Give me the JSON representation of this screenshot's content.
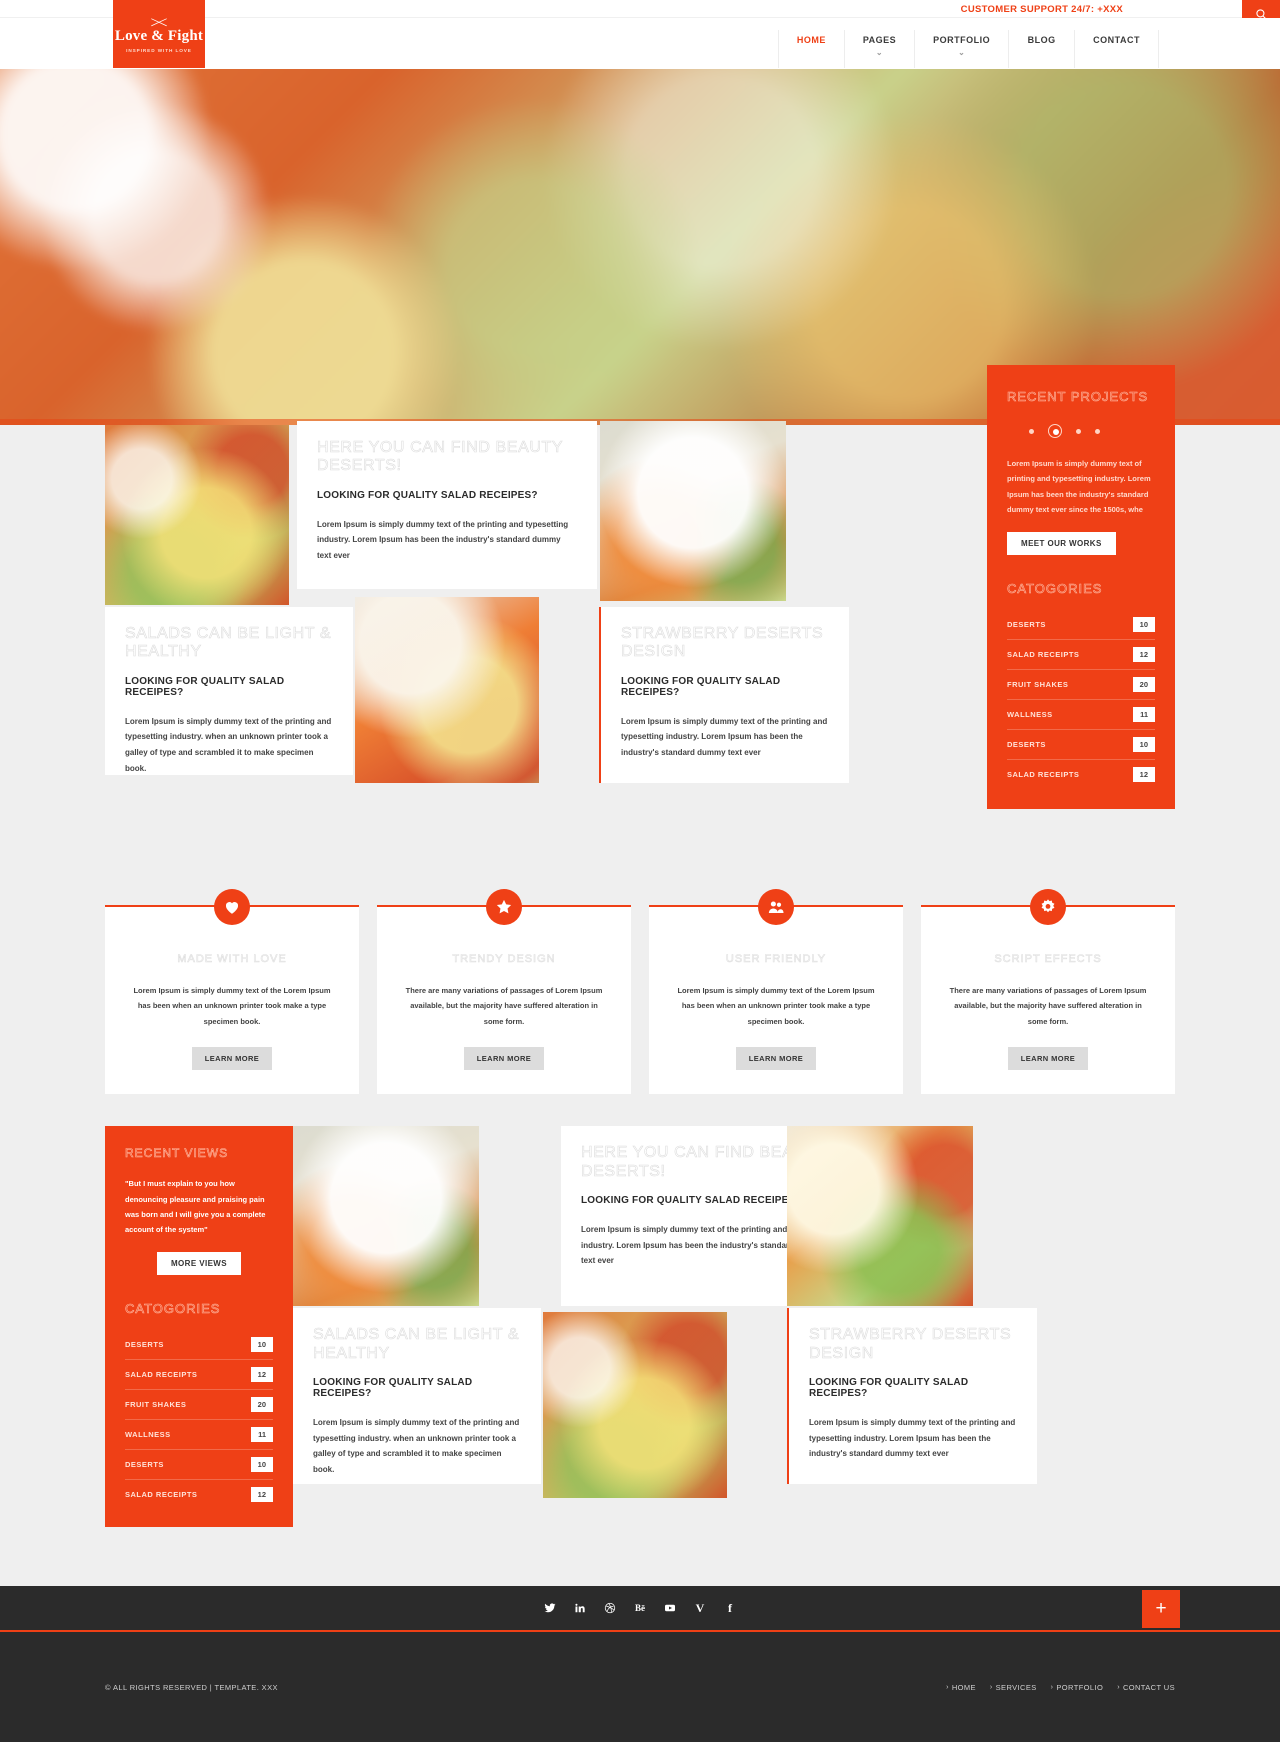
{
  "topbar": {
    "support": "CUSTOMER SUPPORT 24/7: +XXX",
    "search_icon": "search-icon"
  },
  "logo": {
    "title": "Love & Fight",
    "tagline": "INSPIRED WITH LOVE",
    "icon": "crossed-utensils-icon"
  },
  "nav": {
    "items": [
      {
        "label": "HOME",
        "caret": "",
        "active": true
      },
      {
        "label": "PAGES",
        "caret": "⌄",
        "active": false
      },
      {
        "label": "PORTFOLIO",
        "caret": "⌄",
        "active": false
      },
      {
        "label": "BLOG",
        "caret": "",
        "active": false
      },
      {
        "label": "CONTACT",
        "caret": "",
        "active": false
      }
    ]
  },
  "projects_panel": {
    "heading": "RECENT PROJECTS",
    "text": "Lorem Ipsum is simply dummy text of printing and typesetting industry. Lorem Ipsum has been the industry's standard dummy text ever since the 1500s, whe",
    "button": "MEET OUR WORKS",
    "categories_heading": "CATOGORIES",
    "categories": [
      {
        "name": "DESERTS",
        "count": "10"
      },
      {
        "name": "SALAD RECEIPTS",
        "count": "12"
      },
      {
        "name": "FRUIT SHAKES",
        "count": "20"
      },
      {
        "name": "WALLNESS",
        "count": "11"
      },
      {
        "name": "DESERTS",
        "count": "10"
      },
      {
        "name": "SALAD RECEIPTS",
        "count": "12"
      }
    ]
  },
  "cards": {
    "c1": {
      "title": "HERE YOU CAN FIND BEAUTY DESERTS!",
      "subtitle": "LOOKING FOR QUALITY SALAD RECEIPES?",
      "text": "Lorem Ipsum is simply dummy text of the printing and typesetting industry. Lorem Ipsum has been the industry's standard dummy text ever"
    },
    "c2": {
      "title": "SALADS CAN BE LIGHT & HEALTHY",
      "subtitle": "LOOKING FOR QUALITY SALAD RECEIPES?",
      "text": "Lorem Ipsum is simply dummy text of the printing and typesetting industry. when an unknown printer took a galley of type and scrambled it to make specimen book."
    },
    "c3": {
      "title": "STRAWBERRY DESERTS DESIGN",
      "subtitle": "LOOKING FOR QUALITY SALAD RECEIPES?",
      "text": "Lorem Ipsum is simply dummy text of the printing and typesetting industry. Lorem Ipsum has been the industry's standard dummy text ever"
    }
  },
  "features": [
    {
      "icon": "heart-icon",
      "title": "MADE WITH LOVE",
      "text": "Lorem Ipsum is simply dummy text of the Lorem Ipsum has been when an unknown printer took make a type specimen book.",
      "button": "LEARN MORE"
    },
    {
      "icon": "star-icon",
      "title": "TRENDY DESIGN",
      "text": "There are many variations of passages of Lorem Ipsum available, but the majority have suffered alteration in some form.",
      "button": "LEARN MORE"
    },
    {
      "icon": "users-icon",
      "title": "USER FRIENDLY",
      "text": "Lorem Ipsum is simply dummy text of the Lorem Ipsum has been when an unknown printer took make a type specimen book.",
      "button": "LEARN MORE"
    },
    {
      "icon": "gear-icon",
      "title": "SCRIPT EFFECTS",
      "text": "There are many variations of passages of Lorem Ipsum available, but the majority have suffered alteration in some form.",
      "button": "LEARN MORE"
    }
  ],
  "reviews_panel": {
    "heading": "RECENT VIEWS",
    "quote": "\"But I must explain to you how denouncing pleasure and praising pain was born and I will give you a complete account of the system\"",
    "button": "MORE VIEWS",
    "categories_heading": "CATOGORIES",
    "categories": [
      {
        "name": "DESERTS",
        "count": "10"
      },
      {
        "name": "SALAD RECEIPTS",
        "count": "12"
      },
      {
        "name": "FRUIT SHAKES",
        "count": "20"
      },
      {
        "name": "WALLNESS",
        "count": "11"
      },
      {
        "name": "DESERTS",
        "count": "10"
      },
      {
        "name": "SALAD RECEIPTS",
        "count": "12"
      }
    ]
  },
  "cards2": {
    "c1": {
      "title": "HERE YOU CAN FIND BEAUTY DESERTS!",
      "subtitle": "LOOKING FOR QUALITY SALAD RECEIPES?",
      "text": "Lorem Ipsum is simply dummy text of the printing and typesetting industry. Lorem Ipsum has been the industry's standard dummy text ever"
    },
    "c2": {
      "title": "SALADS CAN BE LIGHT & HEALTHY",
      "subtitle": "LOOKING FOR QUALITY SALAD RECEIPES?",
      "text": "Lorem Ipsum is simply dummy text of the printing and typesetting industry. when an unknown printer took a galley of type and scrambled it to make specimen book."
    },
    "c3": {
      "title": "STRAWBERRY DESERTS DESIGN",
      "subtitle": "LOOKING FOR QUALITY SALAD RECEIPES?",
      "text": "Lorem Ipsum is simply dummy text of the printing and typesetting industry. Lorem Ipsum has been the industry's standard dummy text ever"
    }
  },
  "footer": {
    "social": [
      {
        "name": "twitter-icon",
        "glyph": "t"
      },
      {
        "name": "linkedin-icon",
        "glyph": "in"
      },
      {
        "name": "dribbble-icon",
        "glyph": "d"
      },
      {
        "name": "behance-icon",
        "glyph": "Be"
      },
      {
        "name": "youtube-icon",
        "glyph": "yt"
      },
      {
        "name": "vimeo-icon",
        "glyph": "V"
      },
      {
        "name": "facebook-icon",
        "glyph": "f"
      }
    ],
    "plus_label": "+",
    "copyright": "© ALL RIGHTS RESERVED | TEMPLATE. XXX",
    "links": [
      "HOME",
      "SERVICES",
      "PORTFOLIO",
      "CONTACT US"
    ]
  },
  "colors": {
    "accent": "#ef4016",
    "dark": "#2b2b2b",
    "grey_bg": "#efefef"
  }
}
